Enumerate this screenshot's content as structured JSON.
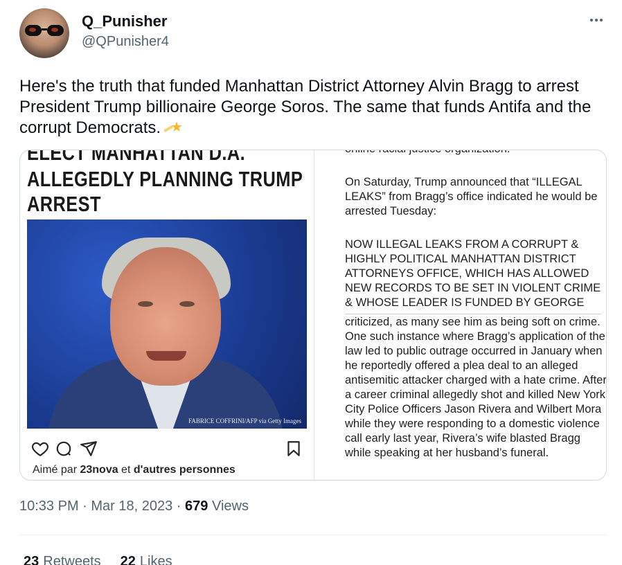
{
  "author": {
    "display_name": "Q_Punisher",
    "handle": "@QPunisher4"
  },
  "tweet": {
    "text": "Here's the truth that funded Manhattan District Attorney Alvin Bragg to arrest President Trump billionaire George Soros. The same that funds Antifa and the corrupt Democrats.",
    "emoji": "sparkle-star-icon"
  },
  "media": {
    "left": {
      "headline_lines": [
        "ELECT MANHATTAN D.A.",
        "ALLEGEDLY PLANNING TRUMP",
        "ARREST"
      ],
      "photo_credit": "FABRICE COFFRINI/AFP via Getty Images",
      "liked_prefix": "Aimé par ",
      "liked_user": "23nova",
      "liked_mid": " et ",
      "liked_suffix": "d'autres personnes"
    },
    "right": {
      "top_fragment": "online racial justice organization.",
      "paragraph1": "On Saturday, Trump announced that “ILLEGAL LEAKS” from Bragg’s office indicated he would be arrested Tuesday:",
      "paragraph2": "NOW ILLEGAL LEAKS FROM A CORRUPT & HIGHLY POLITICAL MANHATTAN DISTRICT ATTORNEYS OFFICE, WHICH HAS ALLOWED NEW RECORDS TO BE SET IN VIOLENT CRIME & WHOSE LEADER IS FUNDED BY GEORGE SOROS, INDICATE THAT, WITH NO CRIME",
      "paragraph3": "criticized, as many see him as being soft on crime. One such instance where Bragg’s application of the law led to public outrage occurred in January when he reportedly offered a plea deal to an alleged antisemitic attacker charged with a hate crime. After a career criminal allegedly shot and killed New York City Police Officers Jason Rivera and Wilbert Mora while they were responding to a domestic violence call early last year, Rivera’s wife blasted Bragg while speaking at her husband’s funeral."
    }
  },
  "meta": {
    "time": "10:33 PM",
    "separator": " · ",
    "date": "Mar 18, 2023",
    "views_count": "679",
    "views_label": " Views"
  },
  "stats": {
    "retweets_count": "23",
    "retweets_label": "Retweets",
    "likes_count": "22",
    "likes_label": "Likes"
  }
}
